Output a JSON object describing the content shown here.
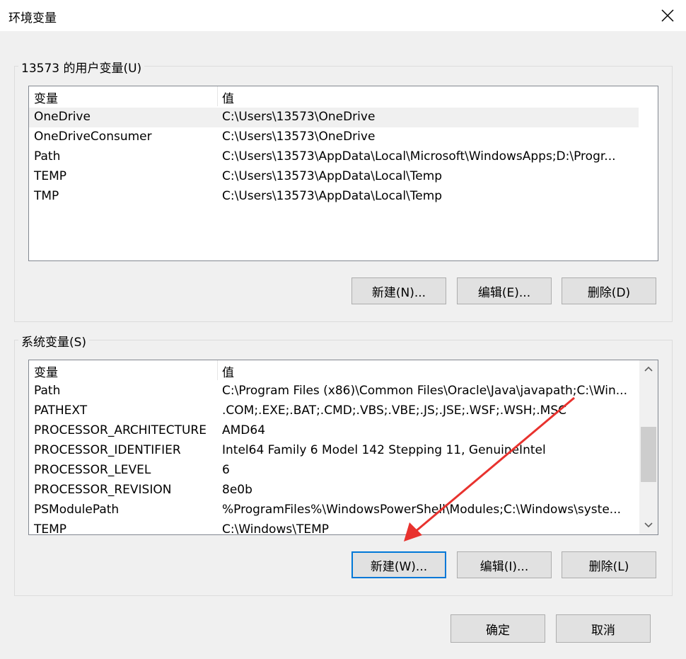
{
  "window": {
    "title": "环境变量"
  },
  "user_group": {
    "legend": "13573 的用户变量(U)",
    "col_var": "变量",
    "col_val": "值",
    "rows": [
      {
        "name": "OneDrive",
        "value": "C:\\Users\\13573\\OneDrive"
      },
      {
        "name": "OneDriveConsumer",
        "value": "C:\\Users\\13573\\OneDrive"
      },
      {
        "name": "Path",
        "value": "C:\\Users\\13573\\AppData\\Local\\Microsoft\\WindowsApps;D:\\Progr..."
      },
      {
        "name": "TEMP",
        "value": "C:\\Users\\13573\\AppData\\Local\\Temp"
      },
      {
        "name": "TMP",
        "value": "C:\\Users\\13573\\AppData\\Local\\Temp"
      }
    ],
    "btn_new": "新建(N)...",
    "btn_edit": "编辑(E)...",
    "btn_delete": "删除(D)"
  },
  "system_group": {
    "legend": "系统变量(S)",
    "col_var": "变量",
    "col_val": "值",
    "rows": [
      {
        "name": "Path",
        "value": "C:\\Program Files (x86)\\Common Files\\Oracle\\Java\\javapath;C:\\Win..."
      },
      {
        "name": "PATHEXT",
        "value": ".COM;.EXE;.BAT;.CMD;.VBS;.VBE;.JS;.JSE;.WSF;.WSH;.MSC"
      },
      {
        "name": "PROCESSOR_ARCHITECTURE",
        "value": "AMD64"
      },
      {
        "name": "PROCESSOR_IDENTIFIER",
        "value": "Intel64 Family 6 Model 142 Stepping 11, GenuineIntel"
      },
      {
        "name": "PROCESSOR_LEVEL",
        "value": "6"
      },
      {
        "name": "PROCESSOR_REVISION",
        "value": "8e0b"
      },
      {
        "name": "PSModulePath",
        "value": "%ProgramFiles%\\WindowsPowerShell\\Modules;C:\\Windows\\syste..."
      },
      {
        "name": "TEMP",
        "value": "C:\\Windows\\TEMP"
      }
    ],
    "btn_new": "新建(W)...",
    "btn_edit": "编辑(I)...",
    "btn_delete": "删除(L)"
  },
  "footer": {
    "ok": "确定",
    "cancel": "取消"
  },
  "colors": {
    "focus_border": "#0078d7",
    "annotation_arrow": "#e8322e",
    "selected_row": "#f0f0f0"
  },
  "icons": {
    "close": "close-icon",
    "scroll_up": "chevron-up-icon",
    "scroll_down": "chevron-down-icon"
  }
}
